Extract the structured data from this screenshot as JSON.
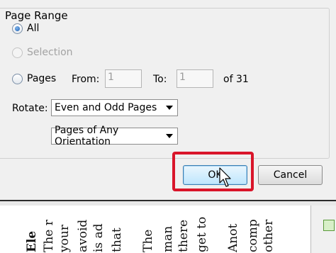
{
  "page_range": {
    "title": "Page Range",
    "all_label": "All",
    "selection_label": "Selection",
    "pages_label": "Pages",
    "from_label": "From:",
    "from_value": "1",
    "to_label": "To:",
    "to_value": "1",
    "of_label": "of 31",
    "selected": "all"
  },
  "rotate": {
    "label": "Rotate:",
    "subset_value": "Even and Odd Pages",
    "orientation_value": "Pages of Any Orientation"
  },
  "buttons": {
    "ok": "OK",
    "cancel": "Cancel"
  },
  "background_text": {
    "columns": [
      "Ele",
      "The r",
      "your",
      "avoid",
      "is ad",
      "that",
      "The",
      "man",
      "there",
      "get to",
      "Anot",
      "comp",
      "other"
    ]
  },
  "colors": {
    "highlight": "#d9152a",
    "dialog_bg": "#f0f0f0"
  }
}
